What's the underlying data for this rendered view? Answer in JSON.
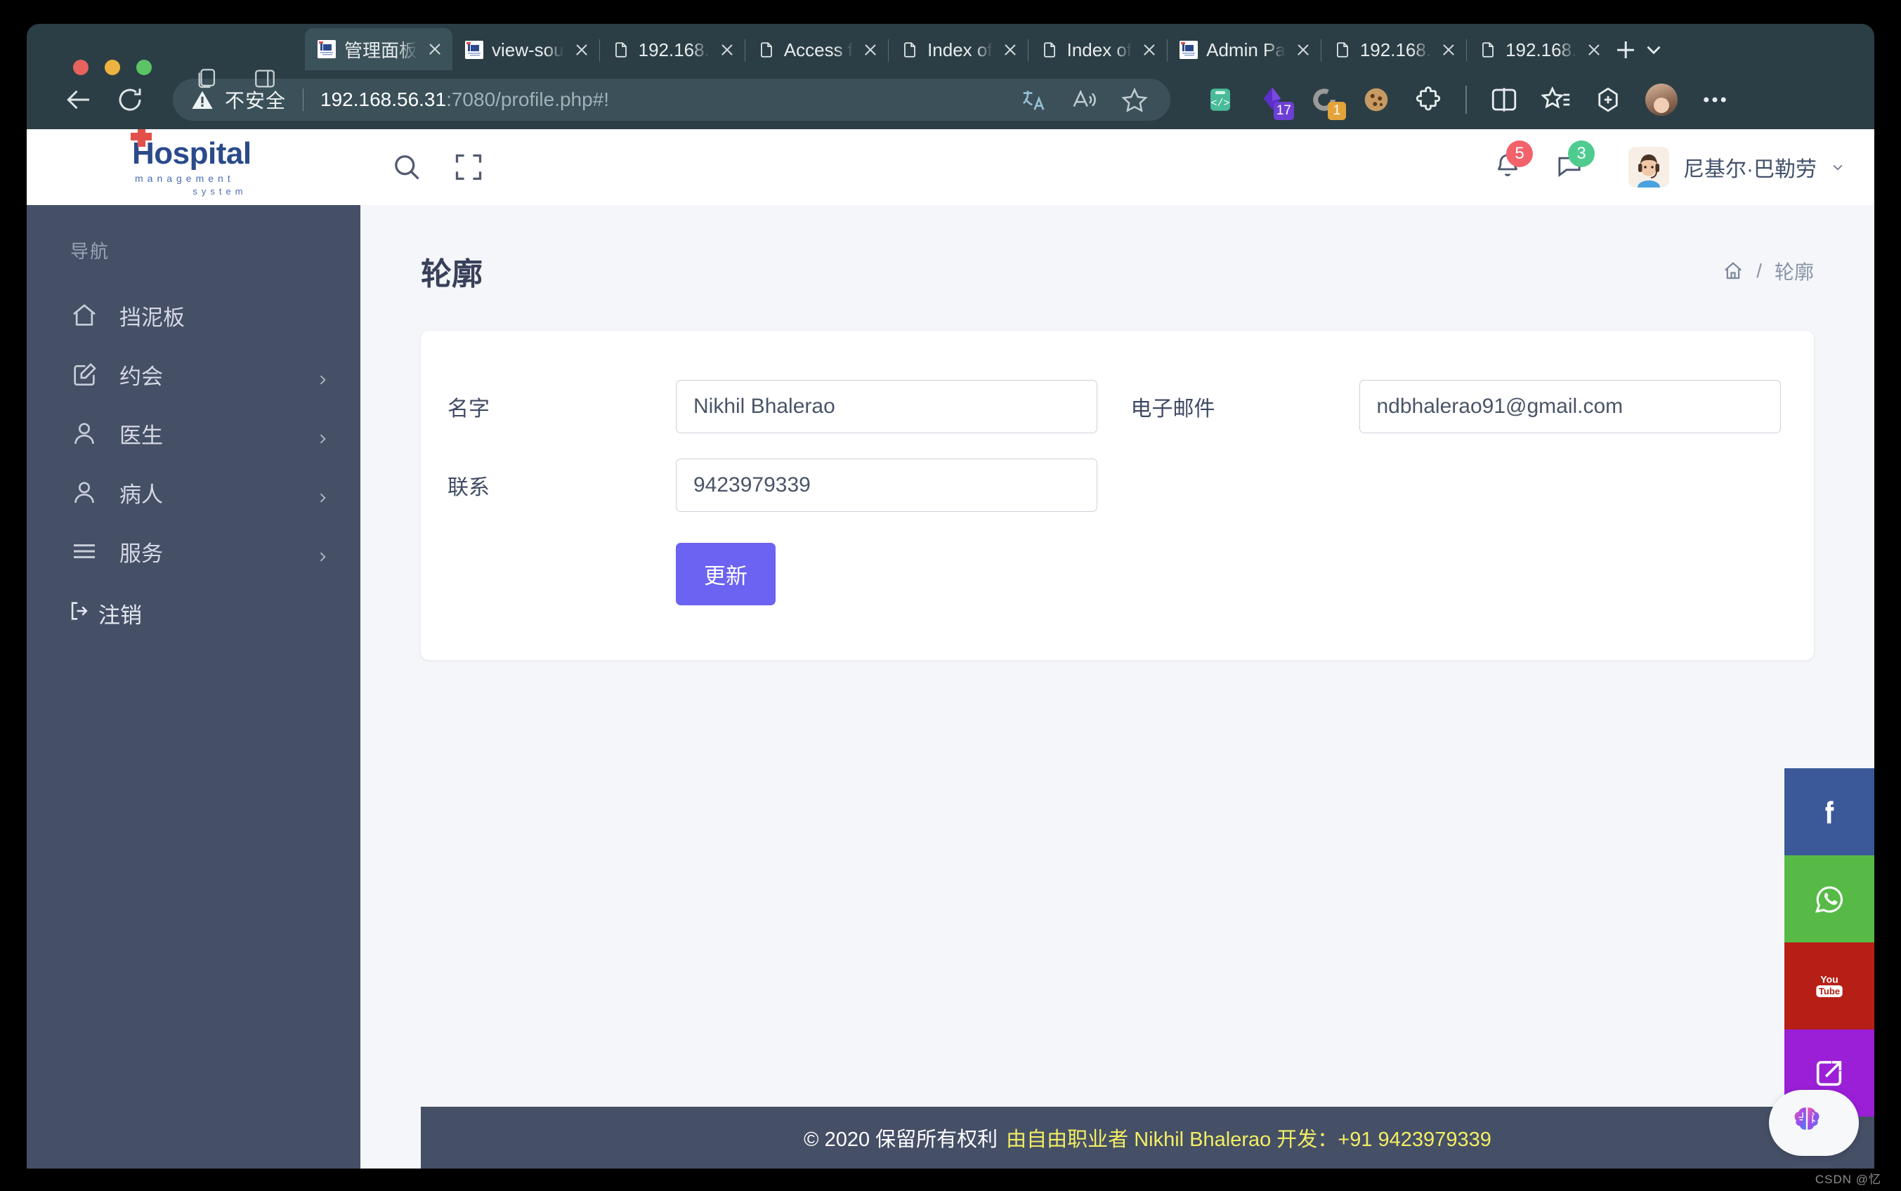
{
  "browser": {
    "tabs": [
      {
        "title": "管理面板",
        "favicon": "hospital-logo",
        "active": true
      },
      {
        "title": "view-sou",
        "favicon": "hospital-logo",
        "active": false
      },
      {
        "title": "192.168.",
        "favicon": "document",
        "active": false
      },
      {
        "title": "Access f",
        "favicon": "document",
        "active": false
      },
      {
        "title": "Index of",
        "favicon": "document",
        "active": false
      },
      {
        "title": "Index of",
        "favicon": "document",
        "active": false
      },
      {
        "title": "Admin Pa",
        "favicon": "hospital-logo",
        "active": false
      },
      {
        "title": "192.168.",
        "favicon": "document",
        "active": false
      },
      {
        "title": "192.168.",
        "favicon": "document",
        "active": false
      }
    ],
    "new_tab_label": "+",
    "tab_list_label": "v",
    "back_icon": "back-arrow-icon",
    "reload_icon": "reload-icon",
    "security": {
      "warning_icon": "warning-triangle-icon",
      "warning_text": "不安全"
    },
    "url": {
      "host": "192.168.56.31",
      "path": ":7080/profile.php#!"
    },
    "omnibox_icons": [
      "translate-icon",
      "read-aloud-icon",
      "favorite-star-icon"
    ],
    "toolbar_extensions": [
      {
        "name": "code-extension-icon",
        "badge": "",
        "badge_color": "#3fbf9a"
      },
      {
        "name": "purple-diamond-extension-icon",
        "badge": "17",
        "badge_color": "#6d3fd6"
      },
      {
        "name": "ring-extension-icon",
        "badge": "1",
        "badge_color": "#e3a43a"
      },
      {
        "name": "cookie-extension-icon",
        "badge": "",
        "badge_color": "#c29057"
      },
      {
        "name": "puzzle-extensions-icon",
        "badge": "",
        "badge_color": "#ffffff"
      }
    ],
    "toolbar_actions": [
      "split-screen-icon",
      "collections-favorites-icon",
      "add-to-collection-icon",
      "profile-avatar",
      "more-options-icon"
    ]
  },
  "app": {
    "logo": {
      "main": "Hospital",
      "sub1": "management",
      "sub2": "system"
    },
    "header": {
      "search_icon": "search-icon",
      "fullscreen_icon": "fullscreen-expand-icon",
      "notifications": {
        "icon": "bell-icon",
        "count": "5",
        "color": "#f1626b"
      },
      "messages": {
        "icon": "chat-bubble-icon",
        "count": "3",
        "color": "#4ecc8f"
      },
      "user": {
        "name": "尼基尔·巴勒劳",
        "avatar": "user-avatar",
        "chevron": "chevron-down-icon"
      }
    },
    "sidebar": {
      "nav_label": "导航",
      "items": [
        {
          "label": "挡泥板",
          "icon": "home-icon",
          "has_arrow": false
        },
        {
          "label": "约会",
          "icon": "edit-square-icon",
          "has_arrow": true
        },
        {
          "label": "医生",
          "icon": "user-icon",
          "has_arrow": true
        },
        {
          "label": "病人",
          "icon": "user-icon",
          "has_arrow": true
        },
        {
          "label": "服务",
          "icon": "list-lines-icon",
          "has_arrow": true
        }
      ],
      "logout": {
        "label": "注销",
        "icon": "logout-icon"
      }
    },
    "page": {
      "title": "轮廓",
      "breadcrumb": {
        "home_icon": "home-icon",
        "separator": "/",
        "current": "轮廓"
      }
    },
    "form": {
      "name": {
        "label": "名字",
        "value": "Nikhil Bhalerao"
      },
      "email": {
        "label": "电子邮件",
        "value": "ndbhalerao91@gmail.com"
      },
      "contact": {
        "label": "联系",
        "value": "9423979339"
      },
      "submit_label": "更新",
      "submit_color": "#6c63f2"
    },
    "footer": {
      "text": "© 2020 保留所有权利",
      "highlight": "由自由职业者 Nikhil Bhalerao 开发：+91 9423979339",
      "highlight_color": "#f3ee63"
    },
    "social": [
      {
        "name": "facebook-button",
        "icon": "facebook-icon",
        "color": "#3b5998"
      },
      {
        "name": "whatsapp-button",
        "icon": "whatsapp-icon",
        "color": "#57ba47"
      },
      {
        "name": "youtube-button",
        "icon": "youtube-icon",
        "color": "#b61f16"
      },
      {
        "name": "external-link-button",
        "icon": "external-link-icon",
        "color": "#9a1fd6"
      }
    ],
    "ai_widget": {
      "icon": "brain-ai-icon"
    }
  },
  "watermark": "CSDN @忆"
}
